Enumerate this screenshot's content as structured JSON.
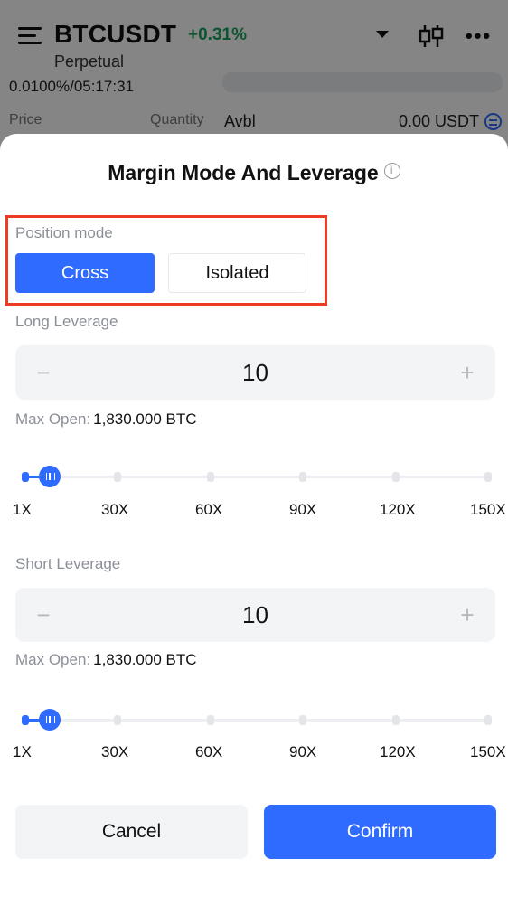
{
  "header": {
    "symbol": "BTCUSDT",
    "change": "+0.31%",
    "subtitle": "Perpetual",
    "funding": "0.0100%/05:17:31",
    "col_price": "Price",
    "col_quantity": "Quantity",
    "avbl_label": "Avbl",
    "avbl_value": "0.00 USDT",
    "change_color": "#1aa35c"
  },
  "modal": {
    "title": "Margin Mode And Leverage",
    "position_mode_label": "Position mode",
    "modes": [
      "Cross",
      "Isolated"
    ],
    "selected_mode": "Cross",
    "long": {
      "label": "Long Leverage",
      "value": "10",
      "max_open_label": "Max Open:",
      "max_open_value": "1,830.000 BTC"
    },
    "short": {
      "label": "Short Leverage",
      "value": "10",
      "max_open_label": "Max Open:",
      "max_open_value": "1,830.000 BTC"
    },
    "slider_ticks": [
      "1X",
      "30X",
      "60X",
      "90X",
      "120X",
      "150X"
    ],
    "slider_min": 1,
    "slider_max": 150,
    "slider_value": 10,
    "cancel_label": "Cancel",
    "confirm_label": "Confirm",
    "accent_color": "#2f6bff",
    "highlight_color": "#ee3a22"
  }
}
